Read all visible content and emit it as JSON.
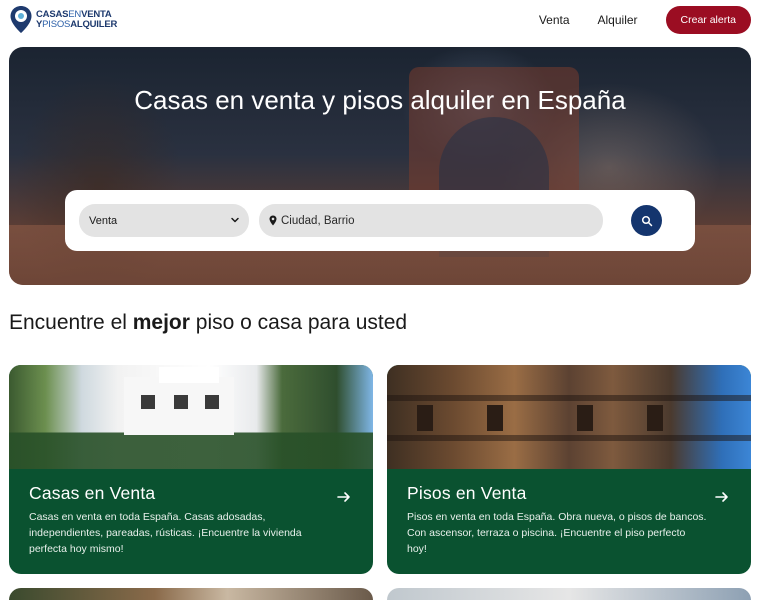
{
  "header": {
    "logo": {
      "line1_a": "CASAS",
      "line1_b": "EN",
      "line1_c": "VENTA",
      "line2_a": "Y",
      "line2_b": "PISOS",
      "line2_c": "ALQUILER"
    },
    "nav": {
      "venta": "Venta",
      "alquiler": "Alquiler",
      "cta": "Crear alerta"
    }
  },
  "hero": {
    "title": "Casas en venta y pisos alquiler en España",
    "search": {
      "operation_selected": "Venta",
      "location_placeholder": "Ciudad, Barrio"
    }
  },
  "section": {
    "title_before": "Encuentre el ",
    "title_bold": "mejor",
    "title_after": " piso o casa para usted"
  },
  "cards": [
    {
      "title": "Casas en Venta",
      "description": "Casas en venta en toda España. Casas adosadas, independientes, pareadas, rústicas. ¡Encuentre la vivienda perfecta hoy mismo!"
    },
    {
      "title": "Pisos en Venta",
      "description": "Pisos en venta en toda España. Obra nueva, o pisos de bancos. Con ascensor, terraza o piscina. ¡Encuentre el piso perfecto hoy!"
    }
  ],
  "colors": {
    "brand_navy": "#14356e",
    "cta_red": "#9b0d22",
    "card_green": "#0a5230"
  },
  "icons": {
    "logo": "location-pin-logo-icon",
    "select": "chevron-down-icon",
    "location": "map-pin-icon",
    "search": "search-icon",
    "card_link": "arrow-right-icon"
  }
}
